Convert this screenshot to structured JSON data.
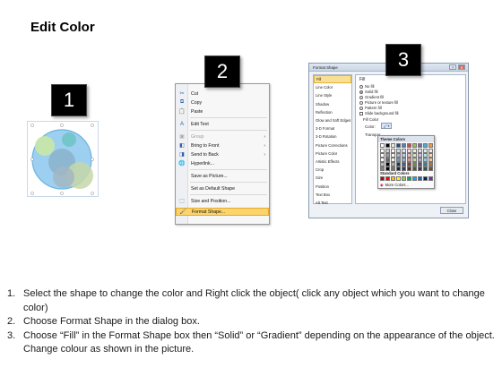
{
  "title": "Edit Color",
  "badges": [
    "1",
    "2",
    "3"
  ],
  "context_menu": {
    "items": [
      {
        "icon": "cut-icon",
        "label": "Cut",
        "disabled": false,
        "submenu": false
      },
      {
        "icon": "copy-icon",
        "label": "Copy",
        "disabled": false,
        "submenu": false
      },
      {
        "icon": "paste-icon",
        "label": "Paste",
        "disabled": false,
        "submenu": false
      },
      {
        "icon": "edit-text-icon",
        "label": "Edit Text",
        "disabled": false,
        "submenu": false
      },
      {
        "icon": "group-icon",
        "label": "Group",
        "disabled": true,
        "submenu": true
      },
      {
        "icon": "bring-front-icon",
        "label": "Bring to Front",
        "disabled": false,
        "submenu": true
      },
      {
        "icon": "send-back-icon",
        "label": "Send to Back",
        "disabled": false,
        "submenu": true
      },
      {
        "icon": "hyperlink-icon",
        "label": "Hyperlink...",
        "disabled": false,
        "submenu": false
      },
      {
        "icon": "",
        "label": "Save as Picture...",
        "disabled": false,
        "submenu": false
      },
      {
        "icon": "",
        "label": "Set as Default Shape",
        "disabled": false,
        "submenu": false
      },
      {
        "icon": "size-icon",
        "label": "Size and Position...",
        "disabled": false,
        "submenu": false
      },
      {
        "icon": "format-shape-icon",
        "label": "Format Shape...",
        "disabled": false,
        "submenu": false,
        "highlighted": true
      }
    ]
  },
  "dialog": {
    "title": "Format Shape",
    "categories": [
      "Fill",
      "Line Color",
      "Line Style",
      "Shadow",
      "Reflection",
      "Glow and Soft Edges",
      "3-D Format",
      "3-D Rotation",
      "Picture Corrections",
      "Picture Color",
      "Artistic Effects",
      "Crop",
      "Size",
      "Position",
      "Text Box",
      "Alt Text"
    ],
    "selected_category": "Fill",
    "section_title": "Fill",
    "options": [
      "No fill",
      "Solid fill",
      "Gradient fill",
      "Picture or texture fill",
      "Pattern fill",
      "Slide background fill"
    ],
    "selected_option": "Solid fill",
    "fill_color_label": "Fill Color",
    "color_label": "Color:",
    "transparency_label": "Transpar",
    "close_label": "Close"
  },
  "palette": {
    "theme_title": "Theme Colors",
    "standard_title": "Standard Colors",
    "more_label": "More Colors...",
    "theme_row": [
      "#ffffff",
      "#000000",
      "#eeece1",
      "#1f497d",
      "#4f81bd",
      "#c0504d",
      "#9bbb59",
      "#8064a2",
      "#4bacc6",
      "#f79646"
    ],
    "standard_row": [
      "#c00000",
      "#ff0000",
      "#ffc000",
      "#ffff00",
      "#92d050",
      "#00b050",
      "#00b0f0",
      "#0070c0",
      "#002060",
      "#7030a0"
    ]
  },
  "steps": [
    {
      "num": "1.",
      "text": "Select the shape to change the color and Right click the object( click any object which you want to change color)"
    },
    {
      "num": "2.",
      "text": "Choose Format Shape in the dialog box."
    },
    {
      "num": "3.",
      "text": "Choose “Fill” in the Format Shape box then “Solid” or “Gradient” depending on the appearance of the object. Change colour as shown in the picture."
    }
  ]
}
